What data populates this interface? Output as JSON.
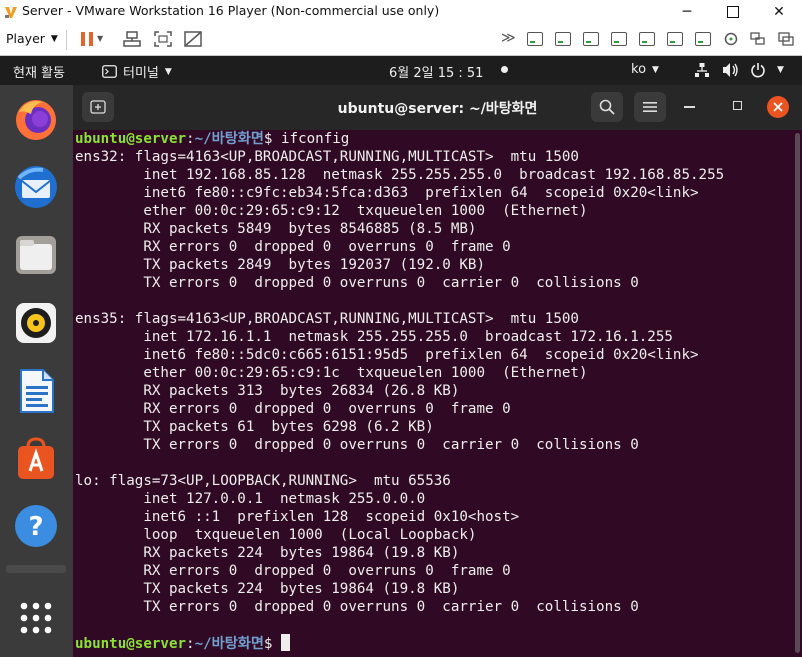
{
  "vmware": {
    "title": "Server - VMware Workstation 16 Player (Non-commercial use only)",
    "player_menu": "Player",
    "colors": {
      "pause": "#e8632b",
      "device_led": "#2e9d3a"
    }
  },
  "ubuntu_topbar": {
    "activities": "현재 활동",
    "app_menu": "터미널",
    "clock": "6월 2일  15 : 51",
    "input_method": "ko"
  },
  "dock": {
    "apps": [
      "firefox-icon",
      "thunderbird-icon",
      "files-icon",
      "rhythmbox-icon",
      "libreoffice-writer-icon",
      "ubuntu-software-icon",
      "help-icon",
      "show-apps-icon"
    ]
  },
  "terminal": {
    "title": "ubuntu@server: ~/바탕화면",
    "prompt_user": "ubuntu@server",
    "prompt_sep": ":",
    "prompt_path": "~/바탕화면",
    "prompt_sym": "$ ",
    "command": "ifconfig",
    "output": [
      "ens32: flags=4163<UP,BROADCAST,RUNNING,MULTICAST>  mtu 1500",
      "        inet 192.168.85.128  netmask 255.255.255.0  broadcast 192.168.85.255",
      "        inet6 fe80::c9fc:eb34:5fca:d363  prefixlen 64  scopeid 0x20<link>",
      "        ether 00:0c:29:65:c9:12  txqueuelen 1000  (Ethernet)",
      "        RX packets 5849  bytes 8546885 (8.5 MB)",
      "        RX errors 0  dropped 0  overruns 0  frame 0",
      "        TX packets 2849  bytes 192037 (192.0 KB)",
      "        TX errors 0  dropped 0 overruns 0  carrier 0  collisions 0",
      "",
      "ens35: flags=4163<UP,BROADCAST,RUNNING,MULTICAST>  mtu 1500",
      "        inet 172.16.1.1  netmask 255.255.255.0  broadcast 172.16.1.255",
      "        inet6 fe80::5dc0:c665:6151:95d5  prefixlen 64  scopeid 0x20<link>",
      "        ether 00:0c:29:65:c9:1c  txqueuelen 1000  (Ethernet)",
      "        RX packets 313  bytes 26834 (26.8 KB)",
      "        RX errors 0  dropped 0  overruns 0  frame 0",
      "        TX packets 61  bytes 6298 (6.2 KB)",
      "        TX errors 0  dropped 0 overruns 0  carrier 0  collisions 0",
      "",
      "lo: flags=73<UP,LOOPBACK,RUNNING>  mtu 65536",
      "        inet 127.0.0.1  netmask 255.0.0.0",
      "        inet6 ::1  prefixlen 128  scopeid 0x10<host>",
      "        loop  txqueuelen 1000  (Local Loopback)",
      "        RX packets 224  bytes 19864 (19.8 KB)",
      "        RX errors 0  dropped 0  overruns 0  frame 0",
      "        TX packets 224  bytes 19864 (19.8 KB)",
      "        TX errors 0  dropped 0 overruns 0  carrier 0  collisions 0",
      ""
    ],
    "colors": {
      "background": "#300a24",
      "prompt_user": "#8ae234",
      "prompt_path": "#729fcf",
      "close_button": "#e95420"
    }
  }
}
